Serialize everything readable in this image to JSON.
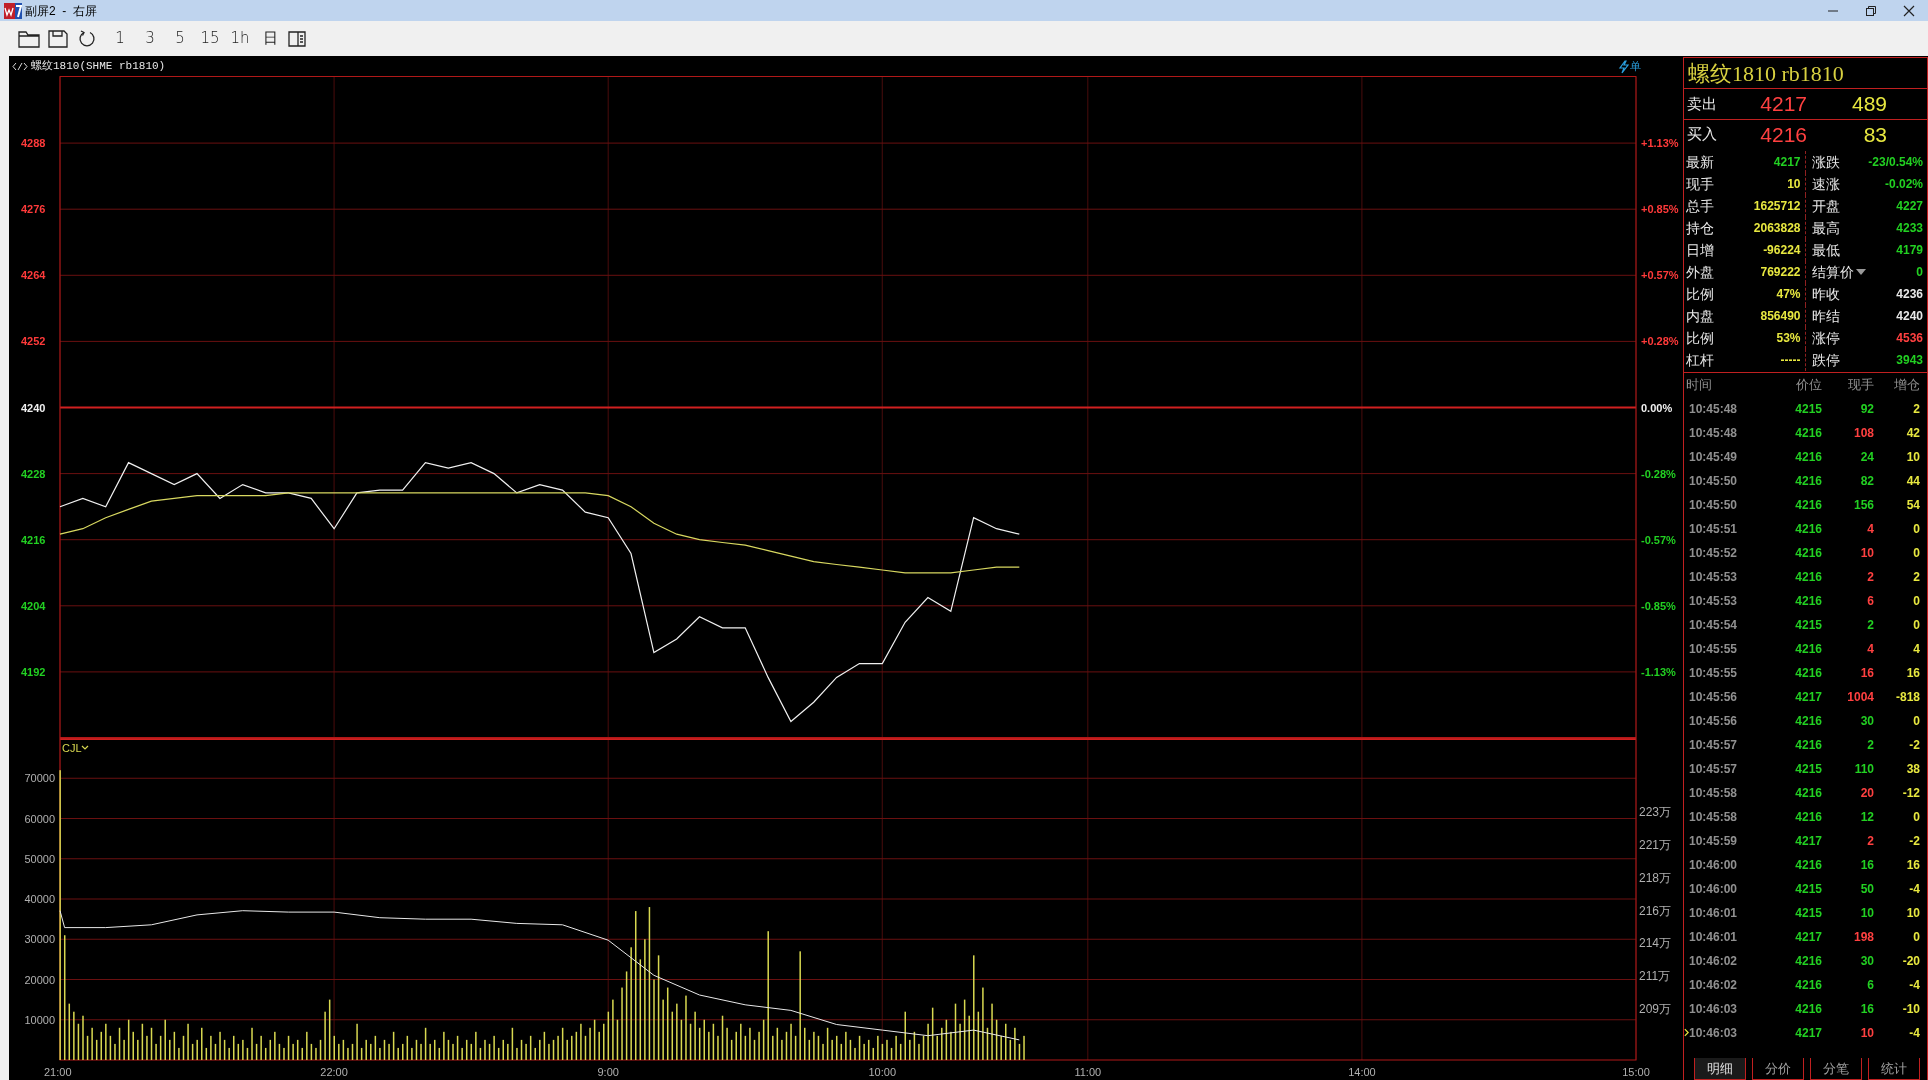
{
  "window": {
    "title": "副屏2  -  右屏"
  },
  "toolbar": {
    "periods": [
      {
        "label": "1"
      },
      {
        "label": "3"
      },
      {
        "label": "5"
      },
      {
        "label": "15"
      },
      {
        "label": "1h"
      },
      {
        "label": "日"
      }
    ]
  },
  "chart_header": {
    "title": "螺纹1810(SHME rb1810)",
    "order_label": "单"
  },
  "price_chart": {
    "chart_data": {
      "type": "line",
      "grid": true,
      "ref_lines": [
        {
          "axis": "y",
          "value": 4240,
          "color": "#d02020"
        }
      ],
      "ylim": [
        4180,
        4300
      ],
      "categories": [
        null,
        null,
        null,
        null,
        null,
        null,
        null,
        null,
        null,
        null,
        null,
        null,
        null,
        null,
        null,
        null,
        null,
        null,
        null,
        null,
        null,
        null,
        null,
        null,
        null,
        null,
        null,
        null,
        null,
        null,
        null,
        null,
        null,
        null,
        null,
        null,
        null,
        null,
        null,
        null,
        null,
        null,
        null,
        null,
        null,
        null,
        null,
        null,
        null,
        null,
        null,
        null,
        null,
        null,
        null,
        null,
        null,
        null,
        null,
        null,
        null,
        null,
        null,
        null,
        null,
        null,
        null,
        null,
        null,
        null
      ],
      "yticks": [
        {
          "value": 4288,
          "label": "4288"
        },
        {
          "value": 4276,
          "label": "4276"
        },
        {
          "value": 4264,
          "label": "4264"
        },
        {
          "value": 4252,
          "label": "4252"
        },
        {
          "value": 4240,
          "label": "4240"
        },
        {
          "value": 4228,
          "label": "4228"
        },
        {
          "value": 4216,
          "label": "4216"
        },
        {
          "value": 4204,
          "label": "4204"
        },
        {
          "value": 4192,
          "label": "4192"
        }
      ],
      "series": [
        {
          "color": "#f0f0f0",
          "values": [
            4222,
            4223.5,
            4222,
            4230,
            4228,
            4226,
            4228,
            4223.5,
            4226,
            4224.5,
            4224.5,
            4223.5,
            4218,
            4224.5,
            4225,
            4225,
            4230,
            4229,
            4230,
            4228,
            4224.5,
            4226,
            4225,
            4221,
            4220,
            4213.5,
            4195.5,
            4198,
            4202,
            4200,
            4200,
            4191,
            4183,
            4186.5,
            4191,
            4193.5,
            4193.5,
            4201,
            4205.5,
            4203,
            4220,
            4218,
            4217,
            null,
            null,
            null,
            null,
            null,
            null,
            null,
            null,
            null,
            null,
            null,
            null,
            null,
            null,
            null,
            null,
            null,
            null,
            null,
            null,
            null,
            null,
            null,
            null,
            null,
            null,
            null
          ]
        },
        {
          "color": "#d8d860",
          "values": [
            4217,
            4218,
            4220,
            4221.5,
            4223,
            4223.5,
            4224,
            4224,
            4224,
            4224,
            4224.5,
            4224.5,
            4224.5,
            4224.5,
            4224.5,
            4224.5,
            4224.5,
            4224.5,
            4224.5,
            4224.5,
            4224.5,
            4224.5,
            4224.5,
            4224.5,
            4224,
            4222,
            4219,
            4217,
            4216,
            4215.5,
            4215,
            4214,
            4213,
            4212,
            4211.5,
            4211,
            4210.5,
            4210,
            4210,
            4210,
            4210.5,
            4211,
            4211,
            null,
            null,
            null,
            null,
            null,
            null,
            null,
            null,
            null,
            null,
            null,
            null,
            null,
            null,
            null,
            null,
            null,
            null,
            null,
            null,
            null,
            null,
            null,
            null,
            null,
            null,
            null
          ]
        }
      ]
    },
    "percent_labels": [
      "+1.13%",
      "+0.85%",
      "+0.57%",
      "+0.28%",
      "0.00%",
      "-0.28%",
      "-0.57%",
      "-0.85%",
      "-1.13%"
    ]
  },
  "volume_chart": {
    "chart_data": {
      "type": "bar",
      "grid": true,
      "title": "CJL",
      "ylim": [
        0,
        80000
      ],
      "categories": [
        "21:00",
        null,
        null,
        null,
        null,
        null,
        null,
        null,
        null,
        null,
        null,
        null,
        null,
        null,
        null,
        null,
        null,
        null,
        null,
        null,
        null,
        null,
        null,
        null,
        null,
        null,
        null,
        null,
        null,
        null,
        null,
        null,
        null,
        null,
        null,
        null,
        null,
        null,
        null,
        null,
        null,
        null,
        null,
        null,
        null,
        null,
        null,
        null,
        null,
        null,
        null,
        null,
        null,
        null,
        null,
        null,
        null,
        null,
        null,
        null,
        "22:00",
        null,
        null,
        null,
        null,
        null,
        null,
        null,
        null,
        null,
        null,
        null,
        null,
        null,
        null,
        null,
        null,
        null,
        null,
        null,
        null,
        null,
        null,
        null,
        null,
        null,
        null,
        null,
        null,
        null,
        null,
        null,
        null,
        null,
        null,
        null,
        null,
        null,
        null,
        null,
        null,
        null,
        null,
        null,
        null,
        null,
        null,
        null,
        null,
        null,
        null,
        null,
        null,
        null,
        null,
        null,
        null,
        null,
        null,
        null,
        "9:00",
        null,
        null,
        null,
        null,
        null,
        null,
        null,
        null,
        null,
        null,
        null,
        null,
        null,
        null,
        null,
        null,
        null,
        null,
        null,
        null,
        null,
        null,
        null,
        null,
        null,
        null,
        null,
        null,
        null,
        null,
        null,
        null,
        null,
        null,
        null,
        null,
        null,
        null,
        null,
        null,
        null,
        null,
        null,
        null,
        null,
        null,
        null,
        null,
        null,
        null,
        null,
        null,
        null,
        null,
        null,
        null,
        null,
        null,
        null,
        "10:00",
        null,
        null,
        null,
        null,
        null,
        null,
        null,
        null,
        null,
        null,
        null,
        null,
        null,
        null,
        null,
        null,
        null,
        null,
        null,
        null,
        null,
        null,
        null,
        null,
        null,
        null,
        null,
        null,
        null,
        null,
        null,
        null,
        null,
        null,
        null,
        null,
        null,
        null,
        null,
        null,
        null,
        null,
        null,
        null,
        "11:00",
        null,
        null,
        null,
        null,
        null,
        null,
        null,
        null,
        null,
        null,
        null,
        null,
        null,
        null,
        null,
        null,
        null,
        null,
        null,
        null,
        null,
        null,
        null,
        null,
        null,
        null,
        null,
        null,
        null,
        null,
        null,
        null,
        null,
        null,
        null,
        null,
        null,
        null,
        null,
        null,
        null,
        null,
        null,
        null,
        null,
        null,
        null,
        null,
        null,
        null,
        null,
        null,
        null,
        null,
        null,
        null,
        null,
        null,
        null,
        "14:00",
        null,
        null,
        null,
        null,
        null,
        null,
        null,
        null,
        null,
        null,
        null,
        null,
        null,
        null,
        null,
        null,
        null,
        null,
        null,
        null,
        null,
        null,
        null,
        null,
        null,
        null,
        null,
        null,
        null,
        null,
        null,
        null,
        null,
        null,
        null,
        null,
        null,
        null,
        null,
        null,
        null,
        null,
        null,
        null,
        null,
        null,
        null,
        null,
        null,
        null,
        null,
        null,
        null,
        null,
        null,
        null,
        null,
        null,
        null,
        "15:00"
      ],
      "yticks": [
        {
          "value": 70000,
          "label": "70000"
        },
        {
          "value": 60000,
          "label": "60000"
        },
        {
          "value": 50000,
          "label": "50000"
        },
        {
          "value": 40000,
          "label": "40000"
        },
        {
          "value": 30000,
          "label": "30000"
        },
        {
          "value": 20000,
          "label": "20000"
        },
        {
          "value": 10000,
          "label": "10000"
        }
      ],
      "y2lim": [
        205.37,
        228.3
      ],
      "y2ticks": [
        {
          "value": 223,
          "label": "223万"
        },
        {
          "value": 220.67,
          "label": "221万"
        },
        {
          "value": 218.33,
          "label": "218万"
        },
        {
          "value": 216,
          "label": "216万"
        },
        {
          "value": 213.67,
          "label": "214万"
        },
        {
          "value": 211.33,
          "label": "211万"
        },
        {
          "value": 209,
          "label": "209万"
        }
      ],
      "series": [
        {
          "type": "bar",
          "color": "#d8d850",
          "values": [
            72000,
            31000,
            14000,
            12000,
            9000,
            11000,
            6000,
            8000,
            5000,
            7000,
            9000,
            6000,
            4000,
            8000,
            5000,
            10000,
            7000,
            5000,
            9000,
            6000,
            8000,
            4000,
            6000,
            10000,
            5000,
            7000,
            3000,
            6000,
            9000,
            4000,
            5000,
            8000,
            3000,
            6000,
            4000,
            7000,
            5000,
            3000,
            6000,
            4000,
            5000,
            3000,
            8000,
            4000,
            6000,
            3000,
            5000,
            7000,
            4000,
            3000,
            6000,
            4000,
            5000,
            3000,
            7000,
            4000,
            3000,
            5000,
            12000,
            15000,
            6000,
            4000,
            5000,
            3000,
            4000,
            9000,
            3000,
            5000,
            4000,
            6000,
            3000,
            5000,
            4000,
            7000,
            3000,
            4000,
            6000,
            3000,
            5000,
            4000,
            8000,
            4000,
            5000,
            3000,
            7000,
            5000,
            4000,
            6000,
            3000,
            5000,
            4000,
            7000,
            3000,
            5000,
            4000,
            6000,
            3000,
            5000,
            4000,
            8000,
            3000,
            5000,
            4000,
            6000,
            3000,
            5000,
            7000,
            4000,
            5000,
            6000,
            8000,
            5000,
            6000,
            7000,
            9000,
            6000,
            8000,
            10000,
            7000,
            9000,
            12000,
            15000,
            10000,
            18000,
            22000,
            28000,
            37000,
            25000,
            30000,
            38000,
            20000,
            26000,
            15000,
            18000,
            12000,
            14000,
            10000,
            16000,
            9000,
            12000,
            8000,
            10000,
            7000,
            9000,
            6000,
            11000,
            8000,
            5000,
            7000,
            9000,
            6000,
            8000,
            5000,
            7000,
            10000,
            32000,
            6000,
            8000,
            5000,
            7000,
            9000,
            6000,
            27000,
            8000,
            5000,
            7000,
            6000,
            4000,
            8000,
            5000,
            6000,
            4000,
            7000,
            5000,
            3000,
            6000,
            4000,
            5000,
            3000,
            6000,
            4000,
            5000,
            3000,
            6000,
            4000,
            12000,
            5000,
            7000,
            4000,
            6000,
            9000,
            13000,
            6000,
            8000,
            10000,
            7000,
            14000,
            9000,
            15000,
            11000,
            26000,
            12000,
            18000,
            8000,
            14000,
            10000,
            6000,
            9000,
            5000,
            8000,
            4000,
            6000,
            null,
            null,
            null,
            null,
            null,
            null,
            null,
            null,
            null,
            null,
            null,
            null,
            null,
            null,
            null,
            null,
            null,
            null,
            null,
            null,
            null,
            null,
            null,
            null,
            null,
            null,
            null,
            null,
            null,
            null,
            null,
            null,
            null,
            null,
            null,
            null,
            null,
            null,
            null,
            null,
            null,
            null,
            null,
            null,
            null,
            null,
            null,
            null,
            null,
            null,
            null,
            null,
            null,
            null,
            null,
            null,
            null,
            null,
            null,
            null,
            null,
            null,
            null,
            null,
            null,
            null,
            null,
            null,
            null,
            null,
            null,
            null,
            null,
            null,
            null,
            null,
            null,
            null,
            null,
            null,
            null,
            null,
            null,
            null,
            null,
            null,
            null,
            null,
            null,
            null,
            null,
            null,
            null,
            null,
            null,
            null,
            null,
            null,
            null,
            null,
            null,
            null,
            null,
            null,
            null,
            null,
            null,
            null,
            null,
            null,
            null,
            null,
            null,
            null,
            null,
            null,
            null,
            null,
            null,
            null,
            null,
            null,
            null,
            null,
            null,
            null,
            null,
            null,
            null,
            null,
            null,
            null,
            null,
            null
          ]
        },
        {
          "type": "line",
          "axis": "y2",
          "color": "#e8e8e8",
          "values": [
            216,
            214.8,
            null,
            null,
            null,
            null,
            null,
            null,
            null,
            null,
            214.8,
            null,
            null,
            null,
            null,
            null,
            null,
            null,
            null,
            null,
            215,
            null,
            null,
            null,
            null,
            null,
            null,
            null,
            null,
            null,
            215.7,
            null,
            null,
            null,
            null,
            null,
            null,
            null,
            null,
            null,
            216,
            null,
            null,
            null,
            null,
            null,
            null,
            null,
            null,
            null,
            215.9,
            null,
            null,
            null,
            null,
            null,
            null,
            null,
            null,
            null,
            215.9,
            null,
            null,
            null,
            null,
            null,
            null,
            null,
            null,
            null,
            215.5,
            null,
            null,
            null,
            null,
            null,
            null,
            null,
            null,
            null,
            215.4,
            null,
            null,
            null,
            null,
            null,
            null,
            null,
            null,
            null,
            215.4,
            null,
            null,
            null,
            null,
            null,
            null,
            null,
            null,
            null,
            215.1,
            null,
            null,
            null,
            null,
            null,
            null,
            null,
            null,
            null,
            215,
            null,
            null,
            null,
            null,
            null,
            null,
            null,
            null,
            null,
            213.9,
            null,
            null,
            null,
            null,
            null,
            null,
            null,
            null,
            null,
            211.4,
            null,
            null,
            null,
            null,
            null,
            null,
            null,
            null,
            null,
            210,
            null,
            null,
            null,
            null,
            null,
            null,
            null,
            null,
            null,
            209.3,
            null,
            null,
            null,
            null,
            null,
            null,
            null,
            null,
            null,
            208.9,
            null,
            null,
            null,
            null,
            null,
            null,
            null,
            null,
            null,
            207.9,
            null,
            null,
            null,
            null,
            null,
            null,
            null,
            null,
            null,
            207.5,
            null,
            null,
            null,
            null,
            null,
            null,
            null,
            null,
            null,
            207.1,
            null,
            null,
            null,
            null,
            null,
            null,
            null,
            null,
            null,
            207.5,
            null,
            null,
            null,
            null,
            null,
            null,
            null,
            null,
            null,
            206.8,
            null,
            null,
            null,
            null,
            null,
            null,
            null,
            null,
            null,
            null,
            null,
            null,
            null,
            null,
            null,
            null,
            null,
            null,
            null,
            null,
            null,
            null,
            null,
            null,
            null,
            null,
            null,
            null,
            null,
            null,
            null,
            null,
            null,
            null,
            null,
            null,
            null,
            null,
            null,
            null,
            null,
            null,
            null,
            null,
            null,
            null,
            null,
            null,
            null,
            null,
            null,
            null,
            null,
            null,
            null,
            null,
            null,
            null,
            null,
            null,
            null,
            null,
            null,
            null,
            null,
            null,
            null,
            null,
            null,
            null,
            null,
            null,
            null,
            null,
            null,
            null,
            null,
            null,
            null,
            null,
            null,
            null,
            null,
            null,
            null,
            null,
            null,
            null,
            null,
            null,
            null,
            null,
            null,
            null,
            null,
            null,
            null,
            null,
            null,
            null,
            null,
            null,
            null,
            null,
            null,
            null,
            null,
            null,
            null,
            null,
            null,
            null,
            null,
            null,
            null,
            null,
            null,
            null,
            null,
            null,
            null,
            null,
            null,
            null,
            null,
            null,
            null,
            null,
            null,
            null,
            null,
            null,
            null,
            null,
            null
          ]
        }
      ]
    }
  },
  "quote": {
    "name": "螺纹1810",
    "code": "rb1810",
    "ask": {
      "label": "卖出",
      "price": "4217",
      "volume": "489"
    },
    "bid": {
      "label": "买入",
      "price": "4216",
      "volume": "83"
    },
    "stats": [
      {
        "label": "最新",
        "value": "4217",
        "color": "#22d022",
        "dropdown": false
      },
      {
        "label": "涨跌",
        "value": "-23/0.54%",
        "color": "#22d022",
        "dropdown": false
      },
      {
        "label": "现手",
        "value": "10",
        "color": "#e8e840",
        "dropdown": false
      },
      {
        "label": "速涨",
        "value": "-0.02%",
        "color": "#22d022",
        "dropdown": false
      },
      {
        "label": "总手",
        "value": "1625712",
        "color": "#e8e840",
        "dropdown": false
      },
      {
        "label": "开盘",
        "value": "4227",
        "color": "#22d022",
        "dropdown": false
      },
      {
        "label": "持仓",
        "value": "2063828",
        "color": "#e8e840",
        "dropdown": false
      },
      {
        "label": "最高",
        "value": "4233",
        "color": "#22d022",
        "dropdown": false
      },
      {
        "label": "日增",
        "value": "-96224",
        "color": "#e8e840",
        "dropdown": false
      },
      {
        "label": "最低",
        "value": "4179",
        "color": "#22d022",
        "dropdown": false
      },
      {
        "label": "外盘",
        "value": "769222",
        "color": "#e8e840",
        "dropdown": false
      },
      {
        "label": "结算价",
        "value": "0",
        "color": "#22d022",
        "dropdown": true
      },
      {
        "label": "比例",
        "value": "47%",
        "color": "#e8e840",
        "dropdown": false
      },
      {
        "label": "昨收",
        "value": "4236",
        "color": "#e8e8e8",
        "dropdown": false
      },
      {
        "label": "内盘",
        "value": "856490",
        "color": "#e8e840",
        "dropdown": false
      },
      {
        "label": "昨结",
        "value": "4240",
        "color": "#e8e8e8",
        "dropdown": false
      },
      {
        "label": "比例",
        "value": "53%",
        "color": "#e8e840",
        "dropdown": false
      },
      {
        "label": "涨停",
        "value": "4536",
        "color": "#ff4040",
        "dropdown": false
      },
      {
        "label": "杠杆",
        "value": "-----",
        "color": "#e8e840",
        "dropdown": false
      },
      {
        "label": "跌停",
        "value": "3943",
        "color": "#22d022",
        "dropdown": false
      }
    ]
  },
  "trades": {
    "columns": [
      "时间",
      "价位",
      "现手",
      "增仓"
    ],
    "rows": [
      {
        "time": "10:45:48",
        "price": "4215",
        "volume": "92",
        "color": "#22d022",
        "change": "2",
        "selected": false
      },
      {
        "time": "10:45:48",
        "price": "4216",
        "volume": "108",
        "color": "#ff4040",
        "change": "42",
        "selected": false
      },
      {
        "time": "10:45:49",
        "price": "4216",
        "volume": "24",
        "color": "#22d022",
        "change": "10",
        "selected": false
      },
      {
        "time": "10:45:50",
        "price": "4216",
        "volume": "82",
        "color": "#22d022",
        "change": "44",
        "selected": false
      },
      {
        "time": "10:45:50",
        "price": "4216",
        "volume": "156",
        "color": "#22d022",
        "change": "54",
        "selected": false
      },
      {
        "time": "10:45:51",
        "price": "4216",
        "volume": "4",
        "color": "#ff4040",
        "change": "0",
        "selected": false
      },
      {
        "time": "10:45:52",
        "price": "4216",
        "volume": "10",
        "color": "#ff4040",
        "change": "0",
        "selected": false
      },
      {
        "time": "10:45:53",
        "price": "4216",
        "volume": "2",
        "color": "#ff4040",
        "change": "2",
        "selected": false
      },
      {
        "time": "10:45:53",
        "price": "4216",
        "volume": "6",
        "color": "#ff4040",
        "change": "0",
        "selected": false
      },
      {
        "time": "10:45:54",
        "price": "4215",
        "volume": "2",
        "color": "#22d022",
        "change": "0",
        "selected": false
      },
      {
        "time": "10:45:55",
        "price": "4216",
        "volume": "4",
        "color": "#ff4040",
        "change": "4",
        "selected": false
      },
      {
        "time": "10:45:55",
        "price": "4216",
        "volume": "16",
        "color": "#ff4040",
        "change": "16",
        "selected": false
      },
      {
        "time": "10:45:56",
        "price": "4217",
        "volume": "1004",
        "color": "#ff4040",
        "change": "-818",
        "selected": false
      },
      {
        "time": "10:45:56",
        "price": "4216",
        "volume": "30",
        "color": "#22d022",
        "change": "0",
        "selected": false
      },
      {
        "time": "10:45:57",
        "price": "4216",
        "volume": "2",
        "color": "#22d022",
        "change": "-2",
        "selected": false
      },
      {
        "time": "10:45:57",
        "price": "4215",
        "volume": "110",
        "color": "#22d022",
        "change": "38",
        "selected": false
      },
      {
        "time": "10:45:58",
        "price": "4216",
        "volume": "20",
        "color": "#ff4040",
        "change": "-12",
        "selected": false
      },
      {
        "time": "10:45:58",
        "price": "4216",
        "volume": "12",
        "color": "#22d022",
        "change": "0",
        "selected": false
      },
      {
        "time": "10:45:59",
        "price": "4217",
        "volume": "2",
        "color": "#ff4040",
        "change": "-2",
        "selected": false
      },
      {
        "time": "10:46:00",
        "price": "4216",
        "volume": "16",
        "color": "#22d022",
        "change": "16",
        "selected": false
      },
      {
        "time": "10:46:00",
        "price": "4215",
        "volume": "50",
        "color": "#22d022",
        "change": "-4",
        "selected": false
      },
      {
        "time": "10:46:01",
        "price": "4215",
        "volume": "10",
        "color": "#22d022",
        "change": "10",
        "selected": false
      },
      {
        "time": "10:46:01",
        "price": "4217",
        "volume": "198",
        "color": "#ff4040",
        "change": "0",
        "selected": false
      },
      {
        "time": "10:46:02",
        "price": "4216",
        "volume": "30",
        "color": "#22d022",
        "change": "-20",
        "selected": false
      },
      {
        "time": "10:46:02",
        "price": "4216",
        "volume": "6",
        "color": "#22d022",
        "change": "-4",
        "selected": false
      },
      {
        "time": "10:46:03",
        "price": "4216",
        "volume": "16",
        "color": "#22d022",
        "change": "-10",
        "selected": false
      },
      {
        "time": "10:46:03",
        "price": "4217",
        "volume": "10",
        "color": "#ff4040",
        "change": "-4",
        "selected": true
      }
    ]
  },
  "bottom_tabs": [
    {
      "label": "明细",
      "selected": true
    },
    {
      "label": "分价",
      "selected": false
    },
    {
      "label": "分笔",
      "selected": false
    },
    {
      "label": "统计",
      "selected": false
    }
  ]
}
